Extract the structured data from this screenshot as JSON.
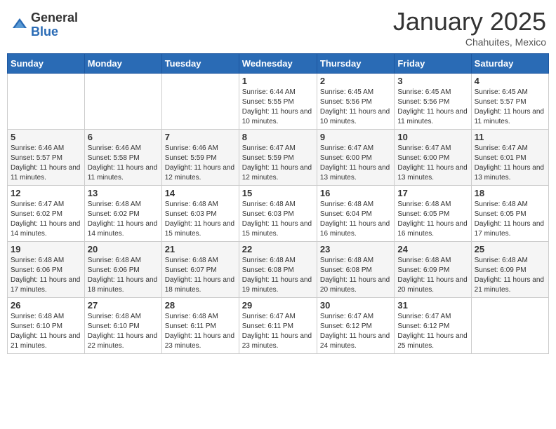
{
  "header": {
    "logo_general": "General",
    "logo_blue": "Blue",
    "month_title": "January 2025",
    "location": "Chahuites, Mexico"
  },
  "days_of_week": [
    "Sunday",
    "Monday",
    "Tuesday",
    "Wednesday",
    "Thursday",
    "Friday",
    "Saturday"
  ],
  "weeks": [
    [
      {
        "day": "",
        "info": ""
      },
      {
        "day": "",
        "info": ""
      },
      {
        "day": "",
        "info": ""
      },
      {
        "day": "1",
        "info": "Sunrise: 6:44 AM\nSunset: 5:55 PM\nDaylight: 11 hours and 10 minutes."
      },
      {
        "day": "2",
        "info": "Sunrise: 6:45 AM\nSunset: 5:56 PM\nDaylight: 11 hours and 10 minutes."
      },
      {
        "day": "3",
        "info": "Sunrise: 6:45 AM\nSunset: 5:56 PM\nDaylight: 11 hours and 11 minutes."
      },
      {
        "day": "4",
        "info": "Sunrise: 6:45 AM\nSunset: 5:57 PM\nDaylight: 11 hours and 11 minutes."
      }
    ],
    [
      {
        "day": "5",
        "info": "Sunrise: 6:46 AM\nSunset: 5:57 PM\nDaylight: 11 hours and 11 minutes."
      },
      {
        "day": "6",
        "info": "Sunrise: 6:46 AM\nSunset: 5:58 PM\nDaylight: 11 hours and 11 minutes."
      },
      {
        "day": "7",
        "info": "Sunrise: 6:46 AM\nSunset: 5:59 PM\nDaylight: 11 hours and 12 minutes."
      },
      {
        "day": "8",
        "info": "Sunrise: 6:47 AM\nSunset: 5:59 PM\nDaylight: 11 hours and 12 minutes."
      },
      {
        "day": "9",
        "info": "Sunrise: 6:47 AM\nSunset: 6:00 PM\nDaylight: 11 hours and 13 minutes."
      },
      {
        "day": "10",
        "info": "Sunrise: 6:47 AM\nSunset: 6:00 PM\nDaylight: 11 hours and 13 minutes."
      },
      {
        "day": "11",
        "info": "Sunrise: 6:47 AM\nSunset: 6:01 PM\nDaylight: 11 hours and 13 minutes."
      }
    ],
    [
      {
        "day": "12",
        "info": "Sunrise: 6:47 AM\nSunset: 6:02 PM\nDaylight: 11 hours and 14 minutes."
      },
      {
        "day": "13",
        "info": "Sunrise: 6:48 AM\nSunset: 6:02 PM\nDaylight: 11 hours and 14 minutes."
      },
      {
        "day": "14",
        "info": "Sunrise: 6:48 AM\nSunset: 6:03 PM\nDaylight: 11 hours and 15 minutes."
      },
      {
        "day": "15",
        "info": "Sunrise: 6:48 AM\nSunset: 6:03 PM\nDaylight: 11 hours and 15 minutes."
      },
      {
        "day": "16",
        "info": "Sunrise: 6:48 AM\nSunset: 6:04 PM\nDaylight: 11 hours and 16 minutes."
      },
      {
        "day": "17",
        "info": "Sunrise: 6:48 AM\nSunset: 6:05 PM\nDaylight: 11 hours and 16 minutes."
      },
      {
        "day": "18",
        "info": "Sunrise: 6:48 AM\nSunset: 6:05 PM\nDaylight: 11 hours and 17 minutes."
      }
    ],
    [
      {
        "day": "19",
        "info": "Sunrise: 6:48 AM\nSunset: 6:06 PM\nDaylight: 11 hours and 17 minutes."
      },
      {
        "day": "20",
        "info": "Sunrise: 6:48 AM\nSunset: 6:06 PM\nDaylight: 11 hours and 18 minutes."
      },
      {
        "day": "21",
        "info": "Sunrise: 6:48 AM\nSunset: 6:07 PM\nDaylight: 11 hours and 18 minutes."
      },
      {
        "day": "22",
        "info": "Sunrise: 6:48 AM\nSunset: 6:08 PM\nDaylight: 11 hours and 19 minutes."
      },
      {
        "day": "23",
        "info": "Sunrise: 6:48 AM\nSunset: 6:08 PM\nDaylight: 11 hours and 20 minutes."
      },
      {
        "day": "24",
        "info": "Sunrise: 6:48 AM\nSunset: 6:09 PM\nDaylight: 11 hours and 20 minutes."
      },
      {
        "day": "25",
        "info": "Sunrise: 6:48 AM\nSunset: 6:09 PM\nDaylight: 11 hours and 21 minutes."
      }
    ],
    [
      {
        "day": "26",
        "info": "Sunrise: 6:48 AM\nSunset: 6:10 PM\nDaylight: 11 hours and 21 minutes."
      },
      {
        "day": "27",
        "info": "Sunrise: 6:48 AM\nSunset: 6:10 PM\nDaylight: 11 hours and 22 minutes."
      },
      {
        "day": "28",
        "info": "Sunrise: 6:48 AM\nSunset: 6:11 PM\nDaylight: 11 hours and 23 minutes."
      },
      {
        "day": "29",
        "info": "Sunrise: 6:47 AM\nSunset: 6:11 PM\nDaylight: 11 hours and 23 minutes."
      },
      {
        "day": "30",
        "info": "Sunrise: 6:47 AM\nSunset: 6:12 PM\nDaylight: 11 hours and 24 minutes."
      },
      {
        "day": "31",
        "info": "Sunrise: 6:47 AM\nSunset: 6:12 PM\nDaylight: 11 hours and 25 minutes."
      },
      {
        "day": "",
        "info": ""
      }
    ]
  ]
}
